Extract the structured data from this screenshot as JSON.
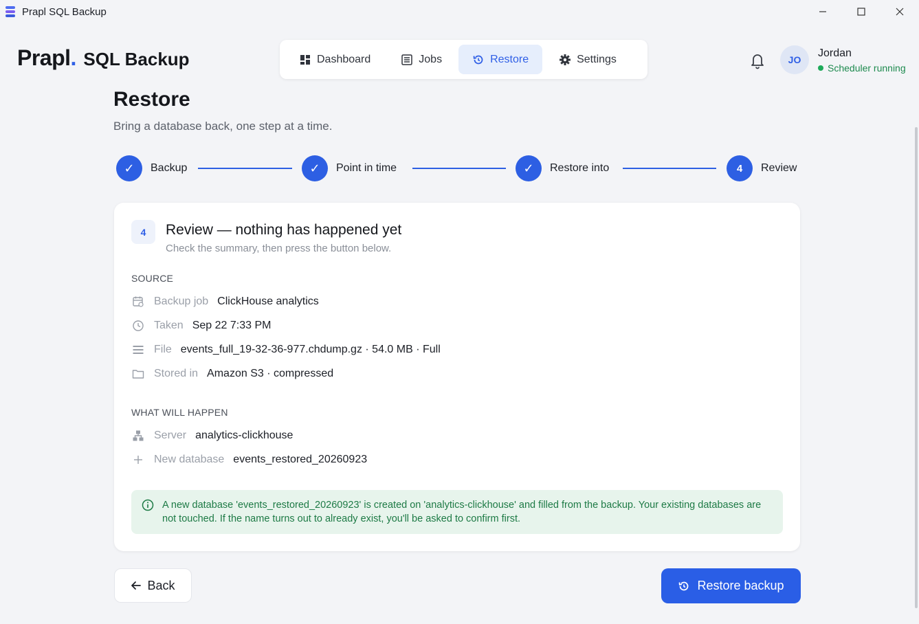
{
  "window": {
    "title": "Prapl SQL Backup"
  },
  "logo": {
    "brand": "Prapl",
    "dot": ".",
    "product": "SQL Backup"
  },
  "nav": {
    "items": [
      {
        "label": "Dashboard",
        "icon": "dashboard-icon",
        "active": false
      },
      {
        "label": "Jobs",
        "icon": "list-icon",
        "active": false
      },
      {
        "label": "Restore",
        "icon": "restore-icon",
        "active": true
      },
      {
        "label": "Settings",
        "icon": "gear-icon",
        "active": false
      }
    ]
  },
  "user": {
    "initials": "JO",
    "name": "Jordan",
    "status": "Scheduler running",
    "status_color": "#1eaa5a"
  },
  "page": {
    "title": "Restore",
    "subtitle": "Bring a database back, one step at a time."
  },
  "stepper": {
    "steps": [
      {
        "label": "Backup",
        "state": "done",
        "mark": "✓"
      },
      {
        "label": "Point in time",
        "state": "done",
        "mark": "✓"
      },
      {
        "label": "Restore into",
        "state": "done",
        "mark": "✓"
      },
      {
        "label": "Review",
        "state": "current",
        "mark": "4"
      }
    ]
  },
  "card": {
    "badge": "4",
    "title": "Review — nothing has happened yet",
    "subtitle": "Check the summary, then press the button below.",
    "source": {
      "label": "SOURCE",
      "rows": [
        {
          "icon": "calendar-icon",
          "key": "Backup job",
          "value": "ClickHouse analytics"
        },
        {
          "icon": "clock-icon",
          "key": "Taken",
          "value": "Sep 22 7:33 PM"
        },
        {
          "icon": "file-list-icon",
          "key": "File",
          "value": "events_full_19-32-36-977.chdump.gz · 54.0 MB · Full"
        },
        {
          "icon": "folder-icon",
          "key": "Stored in",
          "value": "Amazon S3 · compressed"
        }
      ]
    },
    "happen": {
      "label": "WHAT WILL HAPPEN",
      "rows": [
        {
          "icon": "server-hierarchy-icon",
          "key": "Server",
          "value": "analytics-clickhouse"
        },
        {
          "icon": "plus-icon",
          "key": "New database",
          "value": "events_restored_20260923"
        }
      ]
    },
    "notice": "A new database 'events_restored_20260923' is created on 'analytics-clickhouse' and filled from the backup. Your existing databases are not touched. If the name turns out to already exist, you'll be asked to confirm first."
  },
  "actions": {
    "back": "Back",
    "restore": "Restore backup"
  },
  "colors": {
    "accent": "#2a5ee6",
    "notice_bg": "#e7f4ec",
    "notice_text": "#1d7a45"
  }
}
